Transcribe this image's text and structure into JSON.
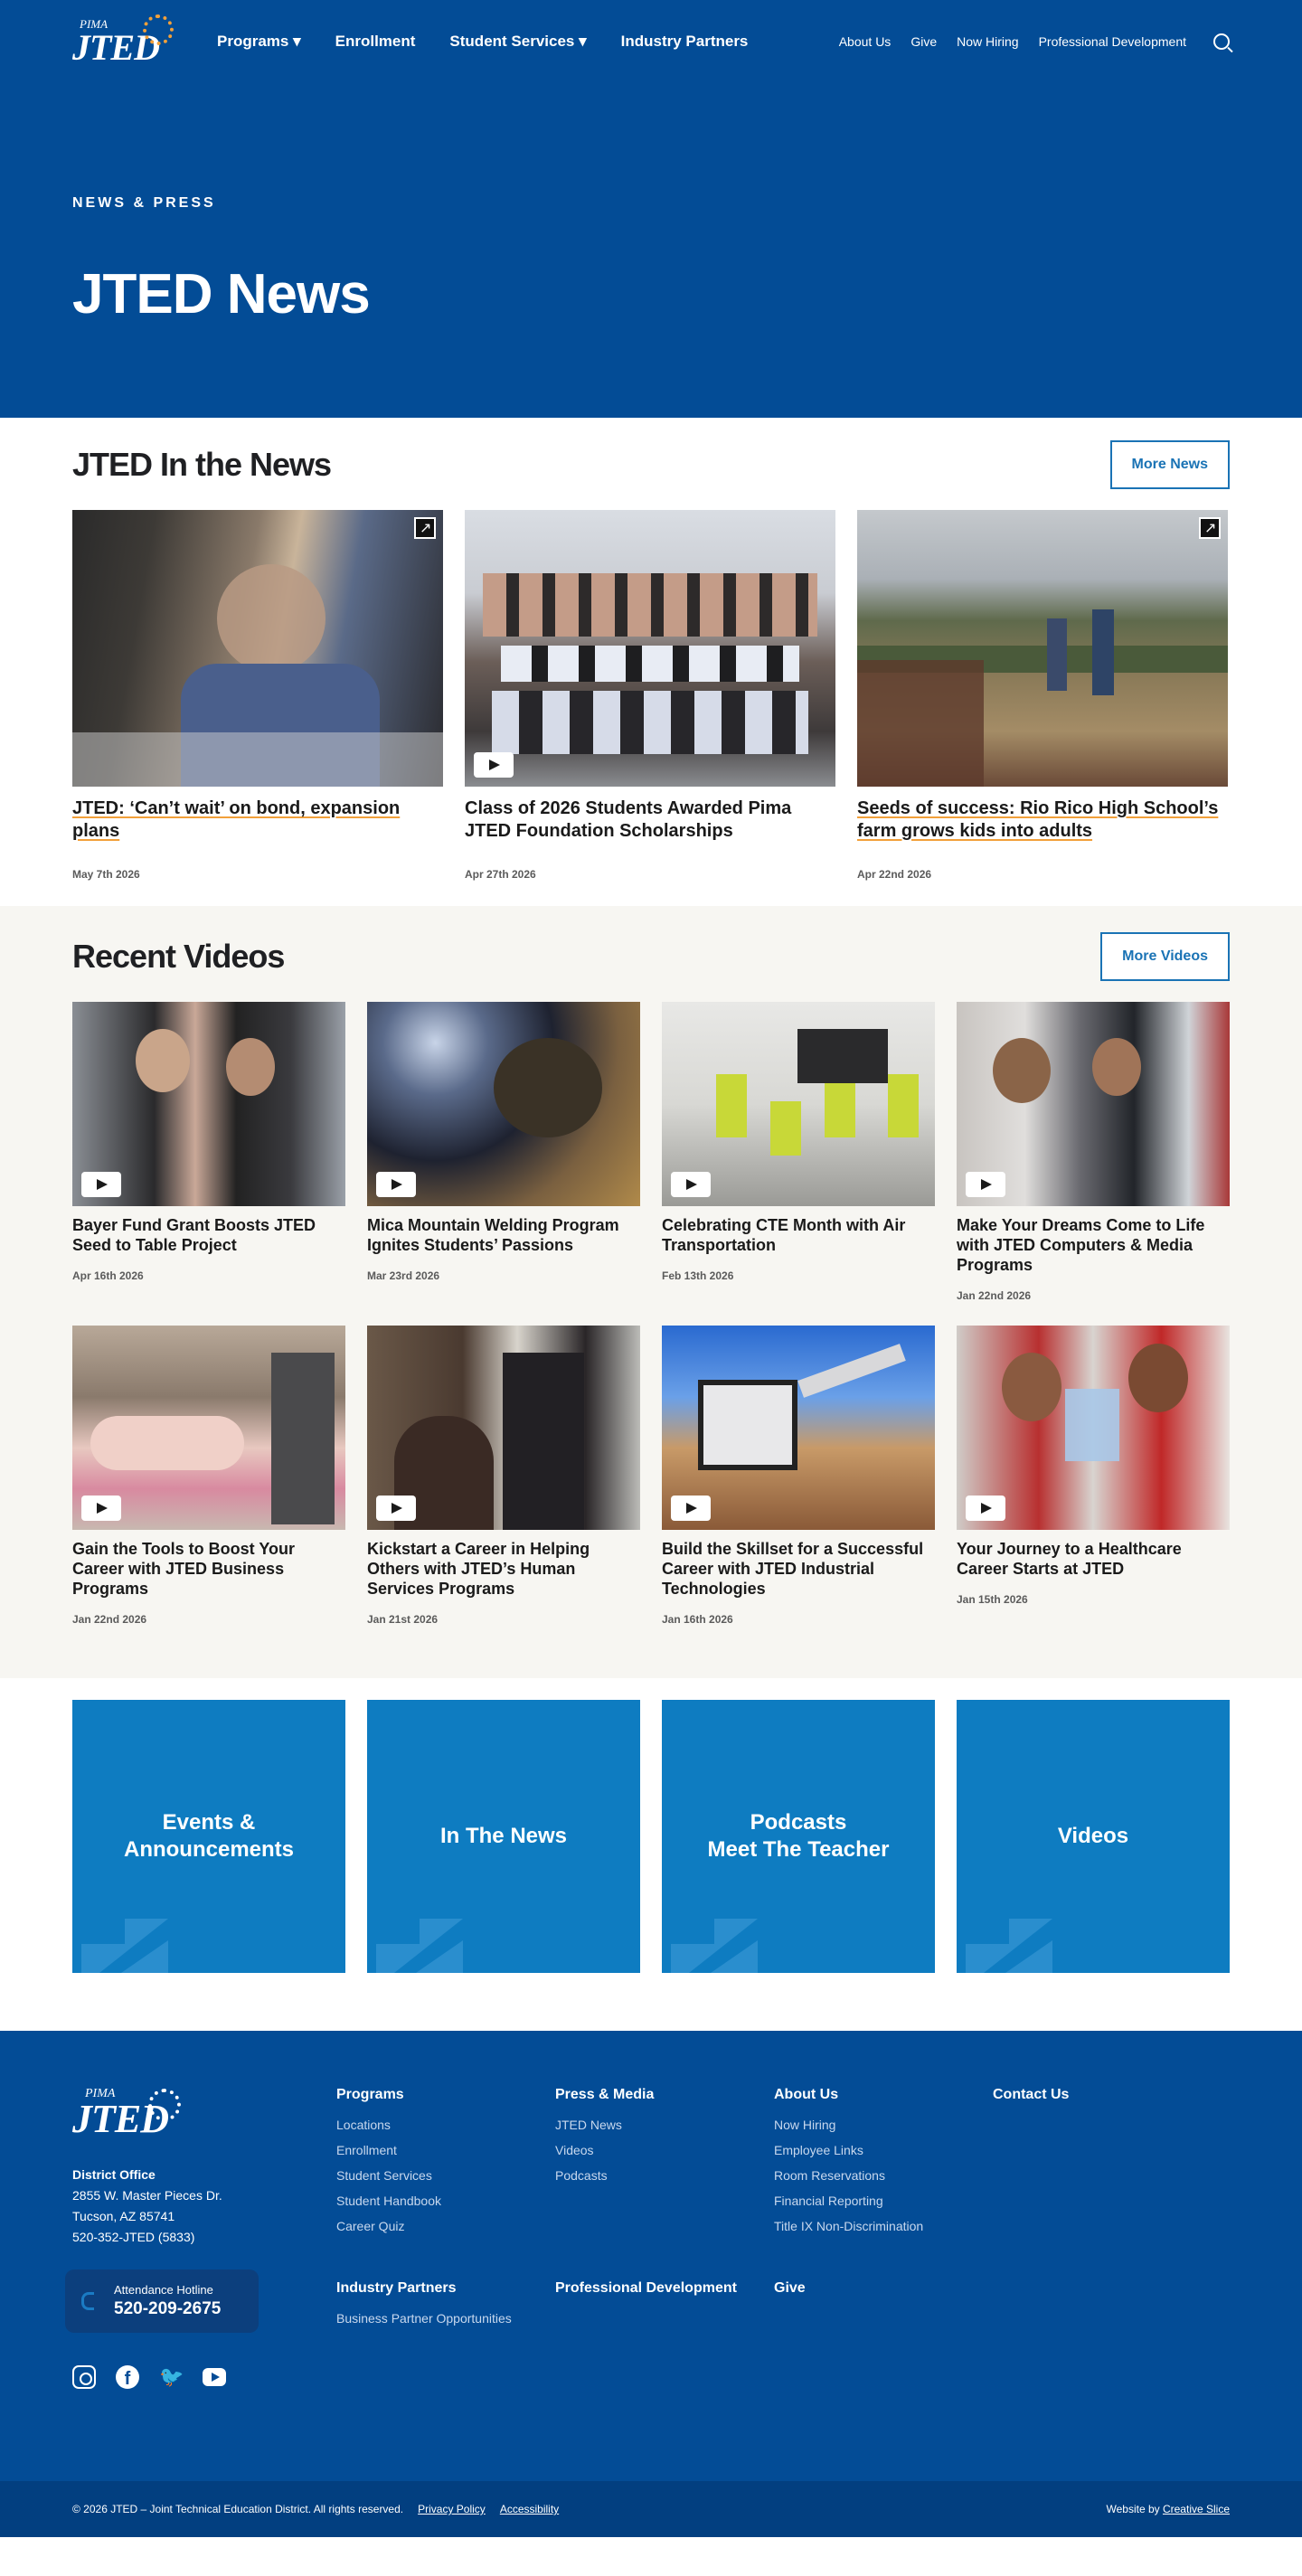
{
  "nav": {
    "logo_top": "PIMA",
    "logo_main": "JTED",
    "main": [
      "Programs ▾",
      "Enrollment",
      "Student Services ▾",
      "Industry Partners"
    ],
    "right": [
      "About Us",
      "Give",
      "Now Hiring",
      "Professional Development"
    ],
    "search_icon": "search-icon"
  },
  "hero": {
    "eyebrow": "NEWS & PRESS",
    "title": "JTED News"
  },
  "news": {
    "title": "JTED In the News",
    "button": "More News",
    "items": [
      {
        "title": "JTED: ‘Can’t wait’ on bond, expansion plans",
        "date": "May 7th 2026",
        "icon": "external-link-icon"
      },
      {
        "title": "Class of 2026 Students Awarded Pima JTED Foundation Scholarships",
        "date": "Apr 27th 2026",
        "icon": "play-icon"
      },
      {
        "title": "Seeds of success: Rio Rico High School’s farm grows kids into adults",
        "date": "Apr 22nd 2026",
        "icon": "external-link-icon"
      }
    ]
  },
  "videos": {
    "title": "Recent Videos",
    "button": "More Videos",
    "items": [
      {
        "title": "Bayer Fund Grant Boosts JTED Seed to Table Project",
        "date": "Apr 16th 2026"
      },
      {
        "title": "Mica Mountain Welding Program Ignites Students’ Passions",
        "date": "Mar 23rd 2026"
      },
      {
        "title": "Celebrating CTE Month with Air Transportation",
        "date": "Feb 13th 2026"
      },
      {
        "title": "Make Your Dreams Come to Life with JTED Computers & Media Programs",
        "date": "Jan 22nd 2026"
      },
      {
        "title": "Gain the Tools to Boost Your Career with JTED Business Programs",
        "date": "Jan 22nd 2026"
      },
      {
        "title": "Kickstart a Career in Helping Others with JTED’s Human Services Programs",
        "date": "Jan 21st 2026"
      },
      {
        "title": "Build the Skillset for a Successful Career with JTED Industrial Technologies",
        "date": "Jan 16th 2026"
      },
      {
        "title": "Your Journey to a Healthcare Career Starts at JTED",
        "date": "Jan 15th 2026"
      }
    ]
  },
  "tiles": [
    {
      "line1": "Events &",
      "line2": "Announcements"
    },
    {
      "line1": "In The News",
      "line2": ""
    },
    {
      "line1": "Podcasts",
      "line2": "Meet The Teacher"
    },
    {
      "line1": "Videos",
      "line2": ""
    }
  ],
  "footer": {
    "logo_top": "PIMA",
    "logo_main": "JTED",
    "office_label": "District Office",
    "address1": "2855 W. Master Pieces Dr.",
    "address2": "Tucson, AZ 85741",
    "phone": "520-352-JTED (5833)",
    "hotline_label": "Attendance Hotline",
    "hotline_number": "520-209-2675",
    "socials": [
      "instagram-icon",
      "facebook-icon",
      "twitter-icon",
      "youtube-icon"
    ],
    "col_programs": {
      "title": "Programs",
      "links": [
        "Locations",
        "Enrollment",
        "Student Services",
        "Student Handbook",
        "Career Quiz"
      ]
    },
    "col_industry": {
      "title": "Industry Partners",
      "links": [
        "Business Partner Opportunities"
      ]
    },
    "col_press": {
      "title": "Press & Media",
      "links": [
        "JTED News",
        "Videos",
        "Podcasts"
      ]
    },
    "col_profdev": {
      "title": "Professional Development"
    },
    "col_about": {
      "title": "About Us",
      "links": [
        "Now Hiring",
        "Employee Links",
        "Room Reservations",
        "Financial Reporting",
        "Title IX Non-Discrimination"
      ]
    },
    "col_give": {
      "title": "Give"
    },
    "col_contact": {
      "title": "Contact Us"
    },
    "copyright": "© 2026 JTED – Joint Technical Education District. All rights reserved.",
    "privacy": "Privacy Policy",
    "accessibility": "Accessibility",
    "credit_prefix": "Website by",
    "credit_link": "Creative Slice"
  },
  "colors": {
    "brand_blue": "#034c96",
    "tile_blue": "#0e7cc1",
    "accent_orange": "#f2a03a",
    "button_blue": "#1a73b5"
  }
}
